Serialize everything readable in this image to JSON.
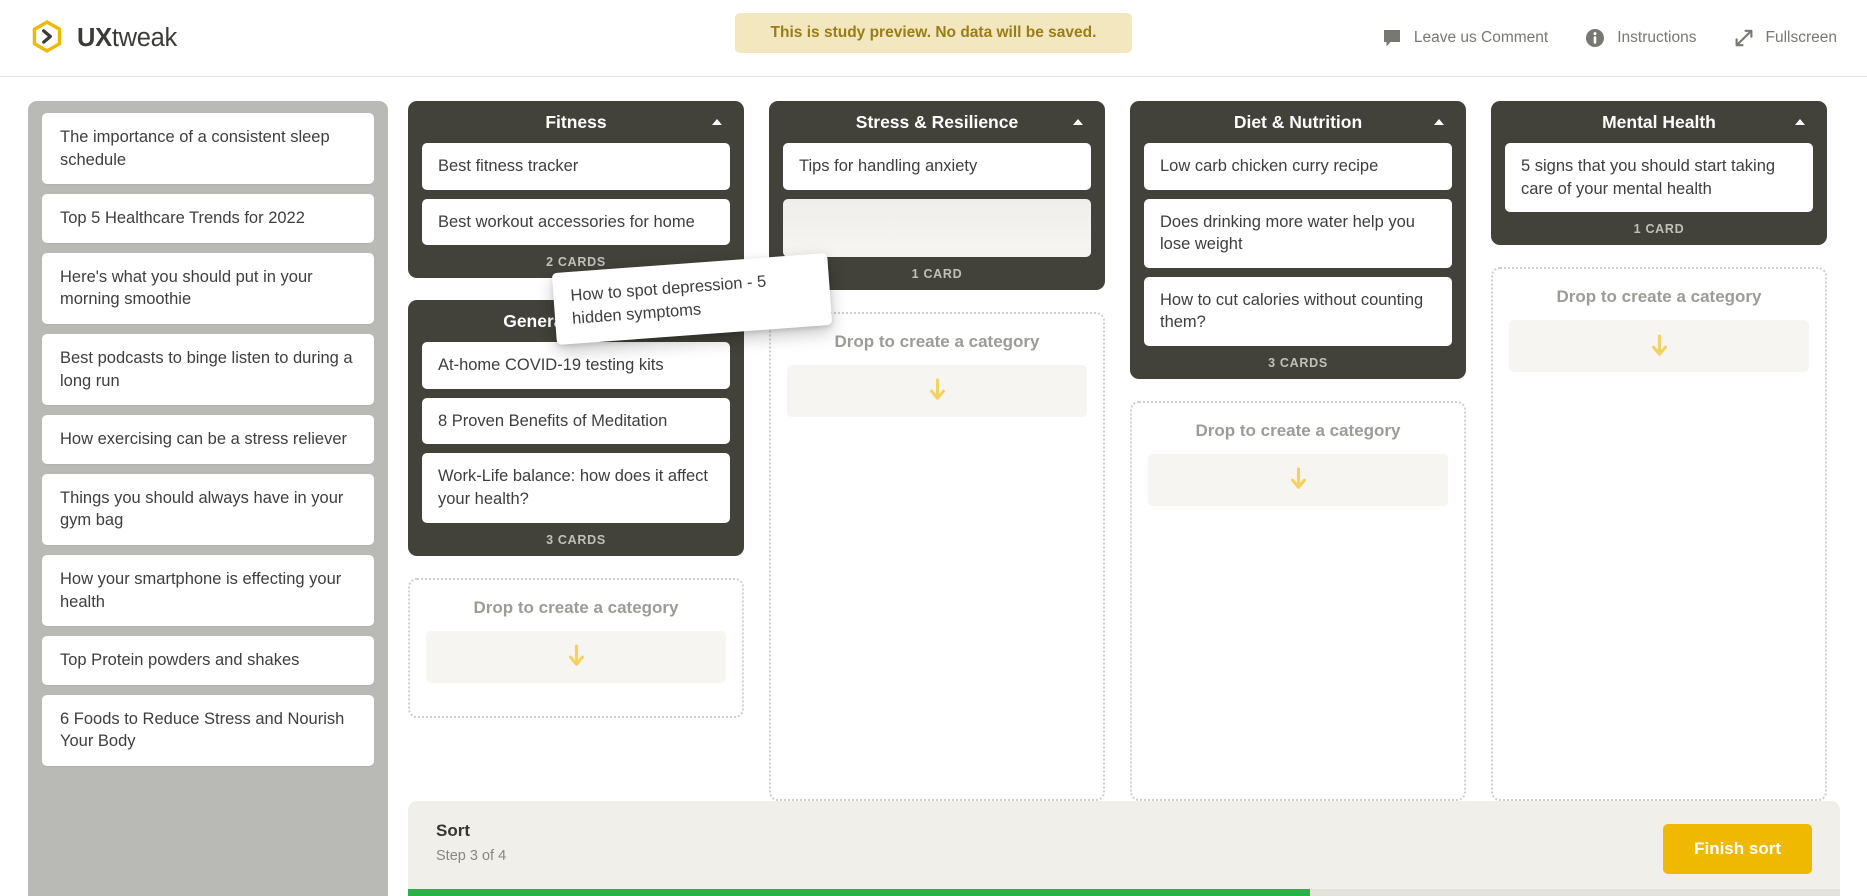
{
  "header": {
    "logo": {
      "bold": "UX",
      "light": "tweak",
      "icon": "uxtweak-hexagon-logo"
    },
    "preview_banner": "This is study preview. No data will be saved.",
    "actions": [
      {
        "label": "Leave us Comment",
        "icon": "comment-icon"
      },
      {
        "label": "Instructions",
        "icon": "info-icon"
      },
      {
        "label": "Fullscreen",
        "icon": "fullscreen-icon"
      }
    ]
  },
  "deck": {
    "cards": [
      "The importance of a consistent sleep schedule",
      "Top 5 Healthcare Trends for 2022",
      "Here's what you should put in your morning smoothie",
      "Best podcasts to binge listen to during a long run",
      "How exercising can be a stress reliever",
      "Things you should always have in your gym bag",
      "How your smartphone is effecting your health",
      "Top Protein powders and shakes",
      "6 Foods to Reduce Stress and Nourish Your Body"
    ]
  },
  "dropzone": {
    "label": "Drop to create a category",
    "arrow_icon": "arrow-down-icon",
    "arrow_color": "#f2d261"
  },
  "columns": [
    {
      "categories": [
        {
          "title": "Fitness",
          "toggle_icon": "triangle-up-icon",
          "cards": [
            "Best fitness tracker",
            "Best workout accessories for home"
          ],
          "count_label": "2 CARDS",
          "placeholder": false
        },
        {
          "title": "General Wellness",
          "toggle_icon": "triangle-up-icon",
          "cards": [
            "At-home COVID-19 testing kits",
            "8 Proven Benefits of Meditation",
            "Work-Life balance: how does it affect your health?"
          ],
          "count_label": "3 CARDS",
          "placeholder": false
        }
      ],
      "has_dropzone": true
    },
    {
      "categories": [
        {
          "title": "Stress & Resilience",
          "toggle_icon": "triangle-up-icon",
          "cards": [
            "Tips for handling anxiety"
          ],
          "count_label": "1 CARD",
          "placeholder": true
        }
      ],
      "has_dropzone": true
    },
    {
      "categories": [
        {
          "title": "Diet & Nutrition",
          "toggle_icon": "triangle-up-icon",
          "cards": [
            "Low carb chicken curry recipe",
            "Does drinking more water help you lose weight",
            "How to cut calories without counting them?"
          ],
          "count_label": "3 CARDS",
          "placeholder": false
        }
      ],
      "has_dropzone": true
    },
    {
      "categories": [
        {
          "title": "Mental Health",
          "toggle_icon": "triangle-up-icon",
          "cards": [
            "5 signs that you should start taking care of your mental health"
          ],
          "count_label": "1 CARD",
          "placeholder": false
        }
      ],
      "has_dropzone": true
    }
  ],
  "dragged_card": {
    "text": "How to spot depression - 5 hidden symptoms"
  },
  "sortbar": {
    "title": "Sort",
    "step": "Step 3 of 4",
    "finish_label": "Finish sort",
    "progress_percent": 63,
    "progress_color": "#2bb14a",
    "button_color": "#eeb900"
  }
}
